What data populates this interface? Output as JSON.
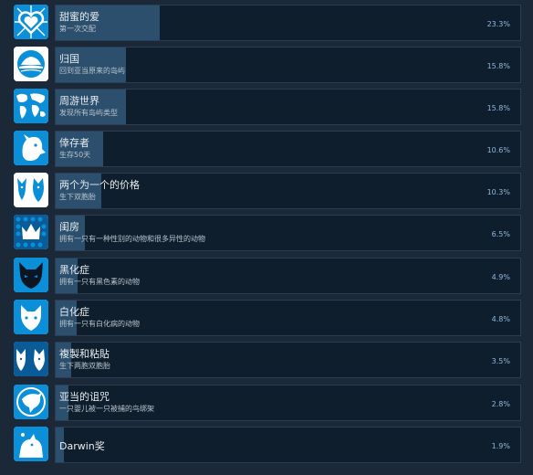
{
  "achievements": [
    {
      "title": "甜蜜的爱",
      "description": "第一次交配",
      "percent": "23.3%",
      "fill": 0.233,
      "icon": "heart-icon"
    },
    {
      "title": "归国",
      "description": "回到亚当原来的岛屿",
      "percent": "15.8%",
      "fill": 0.158,
      "icon": "island-icon"
    },
    {
      "title": "周游世界",
      "description": "发现所有岛屿类型",
      "percent": "15.8%",
      "fill": 0.158,
      "icon": "world-map-icon"
    },
    {
      "title": "倖存者",
      "description": "生存50天",
      "percent": "10.6%",
      "fill": 0.106,
      "icon": "creature-head-icon"
    },
    {
      "title": "两个为一个的价格",
      "description": "生下双胞胎",
      "percent": "10.3%",
      "fill": 0.103,
      "icon": "twin-creatures-icon"
    },
    {
      "title": "闺房",
      "description": "拥有一只有一种性别的动物和很多异性的动物",
      "percent": "6.5%",
      "fill": 0.065,
      "icon": "crown-icon"
    },
    {
      "title": "黑化症",
      "description": "拥有一只有黑色素的动物",
      "percent": "4.9%",
      "fill": 0.049,
      "icon": "black-creature-icon"
    },
    {
      "title": "白化症",
      "description": "拥有一只有白化病的动物",
      "percent": "4.8%",
      "fill": 0.048,
      "icon": "white-creature-icon"
    },
    {
      "title": "複製和粘貼",
      "description": "生下两胞双胞胎",
      "percent": "3.5%",
      "fill": 0.035,
      "icon": "clone-creatures-icon"
    },
    {
      "title": "亚当的诅咒",
      "description": "一只婴儿被一只被捕的鸟绑架",
      "percent": "2.8%",
      "fill": 0.028,
      "icon": "bird-claw-icon"
    },
    {
      "title": "Darwin奖",
      "description": "",
      "percent": "1.9%",
      "fill": 0.019,
      "icon": "darwin-creature-icon"
    }
  ]
}
